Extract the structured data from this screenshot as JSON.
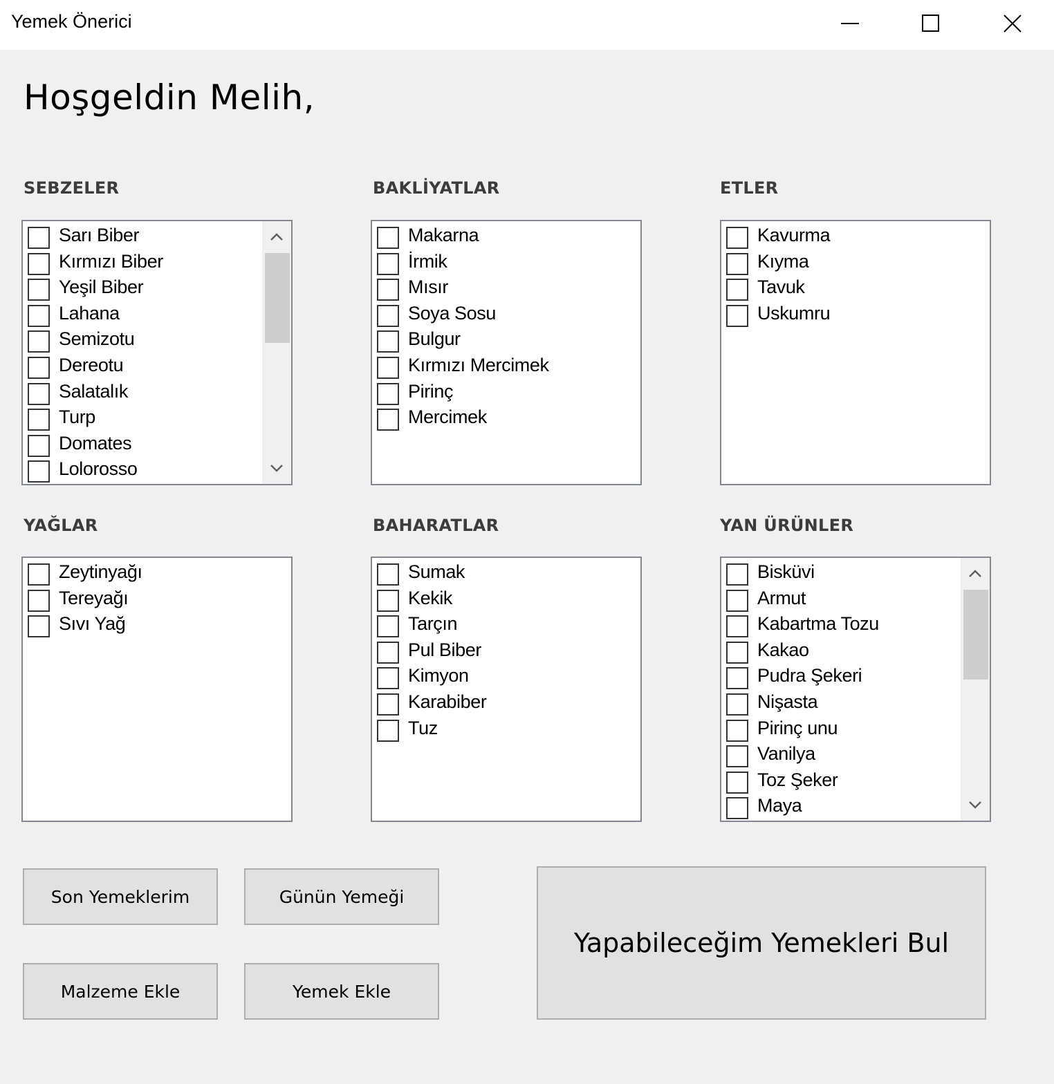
{
  "window": {
    "title": "Yemek Önerici"
  },
  "greeting": "Hoşgeldin Melih,",
  "categories": [
    {
      "label": "SEBZELER",
      "items": [
        "Sarı Biber",
        "Kırmızı Biber",
        "Yeşil Biber",
        "Lahana",
        "Semizotu",
        "Dereotu",
        "Salatalık",
        "Turp",
        "Domates",
        "Lolorosso"
      ],
      "scrollable": true
    },
    {
      "label": "BAKLİYATLAR",
      "items": [
        "Makarna",
        "İrmik",
        "Mısır",
        "Soya Sosu",
        "Bulgur",
        "Kırmızı Mercimek",
        "Pirinç",
        "Mercimek"
      ],
      "scrollable": false
    },
    {
      "label": "ETLER",
      "items": [
        "Kavurma",
        "Kıyma",
        "Tavuk",
        "Uskumru"
      ],
      "scrollable": false
    },
    {
      "label": "YAĞLAR",
      "items": [
        "Zeytinyağı",
        "Tereyağı",
        "Sıvı Yağ"
      ],
      "scrollable": false
    },
    {
      "label": "BAHARATLAR",
      "items": [
        "Sumak",
        "Kekik",
        "Tarçın",
        "Pul Biber",
        "Kimyon",
        "Karabiber",
        "Tuz"
      ],
      "scrollable": false
    },
    {
      "label": "YAN ÜRÜNLER",
      "items": [
        "Bisküvi",
        "Armut",
        "Kabartma Tozu",
        "Kakao",
        "Pudra Şekeri",
        "Nişasta",
        "Pirinç unu",
        "Vanilya",
        "Toz Şeker",
        "Maya"
      ],
      "scrollable": true
    }
  ],
  "buttons": {
    "recent_meals": "Son Yemeklerim",
    "meal_of_day": "Günün Yemeği",
    "add_ingredient": "Malzeme Ekle",
    "add_meal": "Yemek Ekle",
    "find_meals": "Yapabileceğim Yemekleri Bul"
  },
  "icons": {
    "minimize": "minimize-icon",
    "maximize": "maximize-icon",
    "close": "close-icon",
    "checkbox": "checkbox-unchecked-icon",
    "scroll_up": "chevron-up-icon",
    "scroll_down": "chevron-down-icon"
  },
  "colors": {
    "window_bg": "#f0f0f0",
    "titlebar_bg": "#ffffff",
    "listbox_border": "#828790",
    "button_bg": "#e1e1e1",
    "button_border": "#adadad",
    "label_color": "#3c3c3c"
  }
}
